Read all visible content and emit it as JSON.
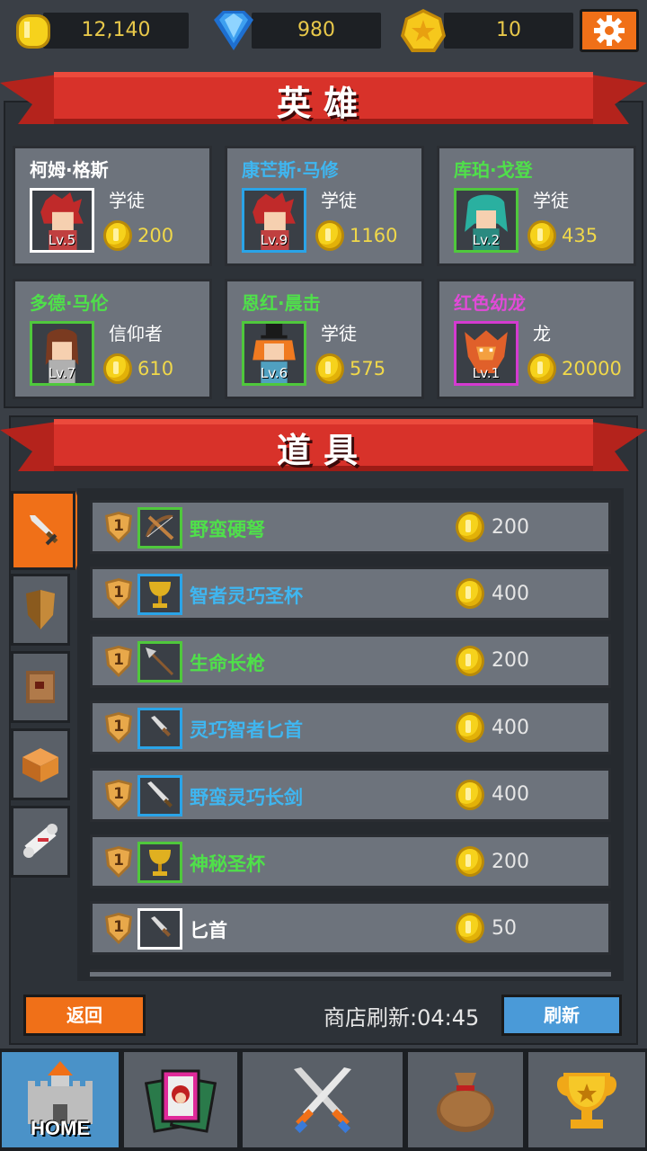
{
  "currency": {
    "gold": "12,140",
    "gems": "980",
    "stars": "10"
  },
  "heroes_section": {
    "title": "英雄"
  },
  "heroes": [
    {
      "name": "柯姆·格斯",
      "level": "Lv.5",
      "class": "学徒",
      "price": "200",
      "name_color": "#ffffff",
      "frame_color": "#ffffff"
    },
    {
      "name": "康芒斯·马修",
      "level": "Lv.9",
      "class": "学徒",
      "price": "1160",
      "name_color": "#3fb6f0",
      "frame_color": "#2aa4e8"
    },
    {
      "name": "库珀·戈登",
      "level": "Lv.2",
      "class": "学徒",
      "price": "435",
      "name_color": "#4fe04a",
      "frame_color": "#4fc83c"
    },
    {
      "name": "多德·马伦",
      "level": "Lv.7",
      "class": "信仰者",
      "price": "610",
      "name_color": "#4fe04a",
      "frame_color": "#4fc83c"
    },
    {
      "name": "恩红·晨击",
      "level": "Lv.6",
      "class": "学徒",
      "price": "575",
      "name_color": "#4fe04a",
      "frame_color": "#4fc83c"
    },
    {
      "name": "红色幼龙",
      "level": "Lv.1",
      "class": "龙",
      "price": "20000",
      "name_color": "#e24ad8",
      "frame_color": "#d43ad0"
    }
  ],
  "items_section": {
    "title": "道具"
  },
  "item_tabs": [
    "sword-icon",
    "shield-icon",
    "book-icon",
    "chest-icon",
    "scroll-icon"
  ],
  "items": [
    {
      "name": "野蛮硬弩",
      "level": "1",
      "price": "200",
      "icon": "crossbow-icon",
      "name_color": "#4fe04a",
      "frame_color": "#4fc83c"
    },
    {
      "name": "智者灵巧圣杯",
      "level": "1",
      "price": "400",
      "icon": "chalice-icon",
      "name_color": "#3fb6f0",
      "frame_color": "#2aa4e8"
    },
    {
      "name": "生命长枪",
      "level": "1",
      "price": "200",
      "icon": "spear-icon",
      "name_color": "#4fe04a",
      "frame_color": "#4fc83c"
    },
    {
      "name": "灵巧智者匕首",
      "level": "1",
      "price": "400",
      "icon": "dagger-icon",
      "name_color": "#3fb6f0",
      "frame_color": "#2aa4e8"
    },
    {
      "name": "野蛮灵巧长剑",
      "level": "1",
      "price": "400",
      "icon": "longsword-icon",
      "name_color": "#3fb6f0",
      "frame_color": "#2aa4e8"
    },
    {
      "name": "神秘圣杯",
      "level": "1",
      "price": "200",
      "icon": "chalice-icon",
      "name_color": "#4fe04a",
      "frame_color": "#4fc83c"
    },
    {
      "name": "匕首",
      "level": "1",
      "price": "50",
      "icon": "dagger-icon",
      "name_color": "#ffffff",
      "frame_color": "#ffffff"
    }
  ],
  "controls": {
    "back_label": "返回",
    "refresh_timer": "商店刷新:04:45",
    "refresh_label": "刷新"
  },
  "nav": {
    "home_label": "HOME",
    "items": [
      "castle-icon",
      "hero-cards-icon",
      "crossed-swords-icon",
      "loot-bag-icon",
      "trophy-icon"
    ]
  }
}
